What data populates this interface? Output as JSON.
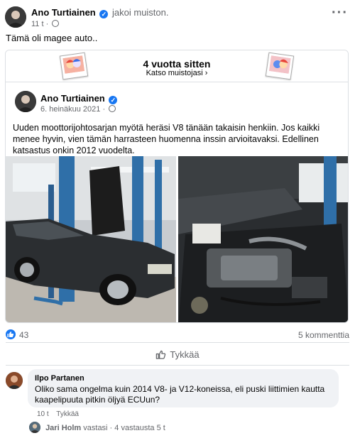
{
  "post": {
    "author": "Ano Turtiainen",
    "action": "jakoi muiston.",
    "time": "11 t",
    "more": "···",
    "text": "Tämä oli magee auto.."
  },
  "memory": {
    "title": "4 vuotta sitten",
    "link": "Katso muistojasi",
    "shared": {
      "author": "Ano Turtiainen",
      "date": "6. heinäkuu 2021",
      "text": "Uuden moottorijohtosarjan myötä heräsi V8 tänään takaisin henkiin. Jos kaikki menee hyvin, vien tämän harrasteen huomenna inssin arvioitavaksi. Edellinen katsastus onkin 2012 vuodelta."
    }
  },
  "reactions": {
    "likes": "43",
    "comments": "5 kommenttia"
  },
  "actions": {
    "like_label": "Tykkää"
  },
  "comment": {
    "author": "Ilpo Partanen",
    "text": "Oliko sama ongelma kuin 2014 V8- ja V12-koneissa, eli puski liittimien kautta kaapelipuuta pitkin öljyä ECUun?",
    "time": "10 t",
    "like_label": "Tykkää"
  },
  "reply": {
    "author": "Jari Holm",
    "text": "vastasi · 4 vastausta",
    "time": "5 t"
  },
  "colors": {
    "accent": "#1877f2",
    "muted": "#65676b",
    "bubble": "#f0f2f5"
  }
}
